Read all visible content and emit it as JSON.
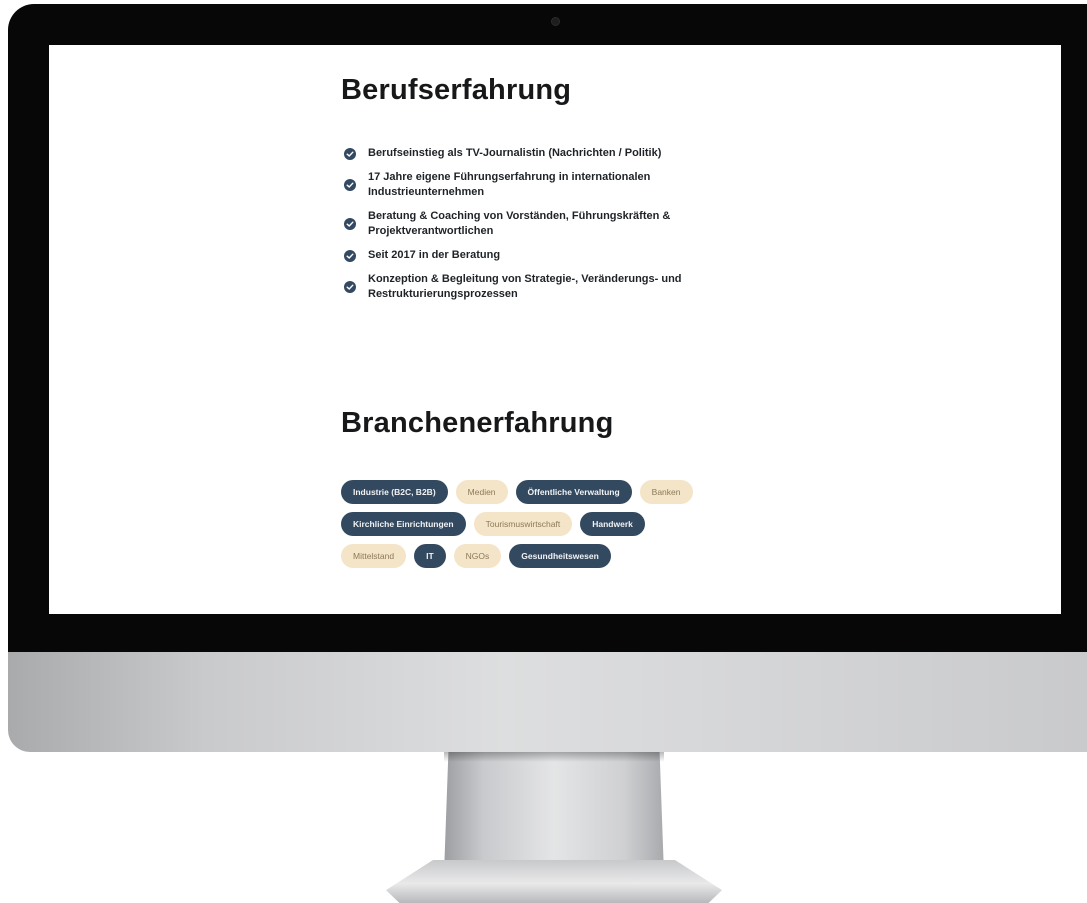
{
  "sections": {
    "berufserfahrung": {
      "title": "Berufserfahrung",
      "items": [
        "Berufseinstieg als TV-Journalistin (Nachrichten / Politik)",
        "17 Jahre eigene Führungserfahrung in internationalen Industrieunternehmen",
        "Beratung & Coaching von Vorständen, Führungskräften & Projektverantwortlichen",
        "Seit 2017 in der Beratung",
        "Konzeption & Begleitung von Strategie-, Veränderungs- und Restrukturierungsprozessen"
      ]
    },
    "branchenerfahrung": {
      "title": "Branchenerfahrung",
      "tags": [
        {
          "label": "Industrie (B2C, B2B)",
          "style": "dark"
        },
        {
          "label": "Medien",
          "style": "light"
        },
        {
          "label": "Öffentliche Verwaltung",
          "style": "dark"
        },
        {
          "label": "Banken",
          "style": "light"
        },
        {
          "label": "Kirchliche Einrichtungen",
          "style": "dark"
        },
        {
          "label": "Tourismuswirtschaft",
          "style": "light"
        },
        {
          "label": "Handwerk",
          "style": "dark"
        },
        {
          "label": "Mittelstand",
          "style": "light"
        },
        {
          "label": "IT",
          "style": "dark"
        },
        {
          "label": "NGOs",
          "style": "light"
        },
        {
          "label": "Gesundheitswesen",
          "style": "dark"
        }
      ]
    }
  },
  "icons": {
    "list_bullet": "check-circle-icon"
  },
  "colors": {
    "heading": "#17181a",
    "tag_dark_bg": "#33495f",
    "tag_light_bg": "#f4e4c8",
    "check_bg": "#334962"
  }
}
